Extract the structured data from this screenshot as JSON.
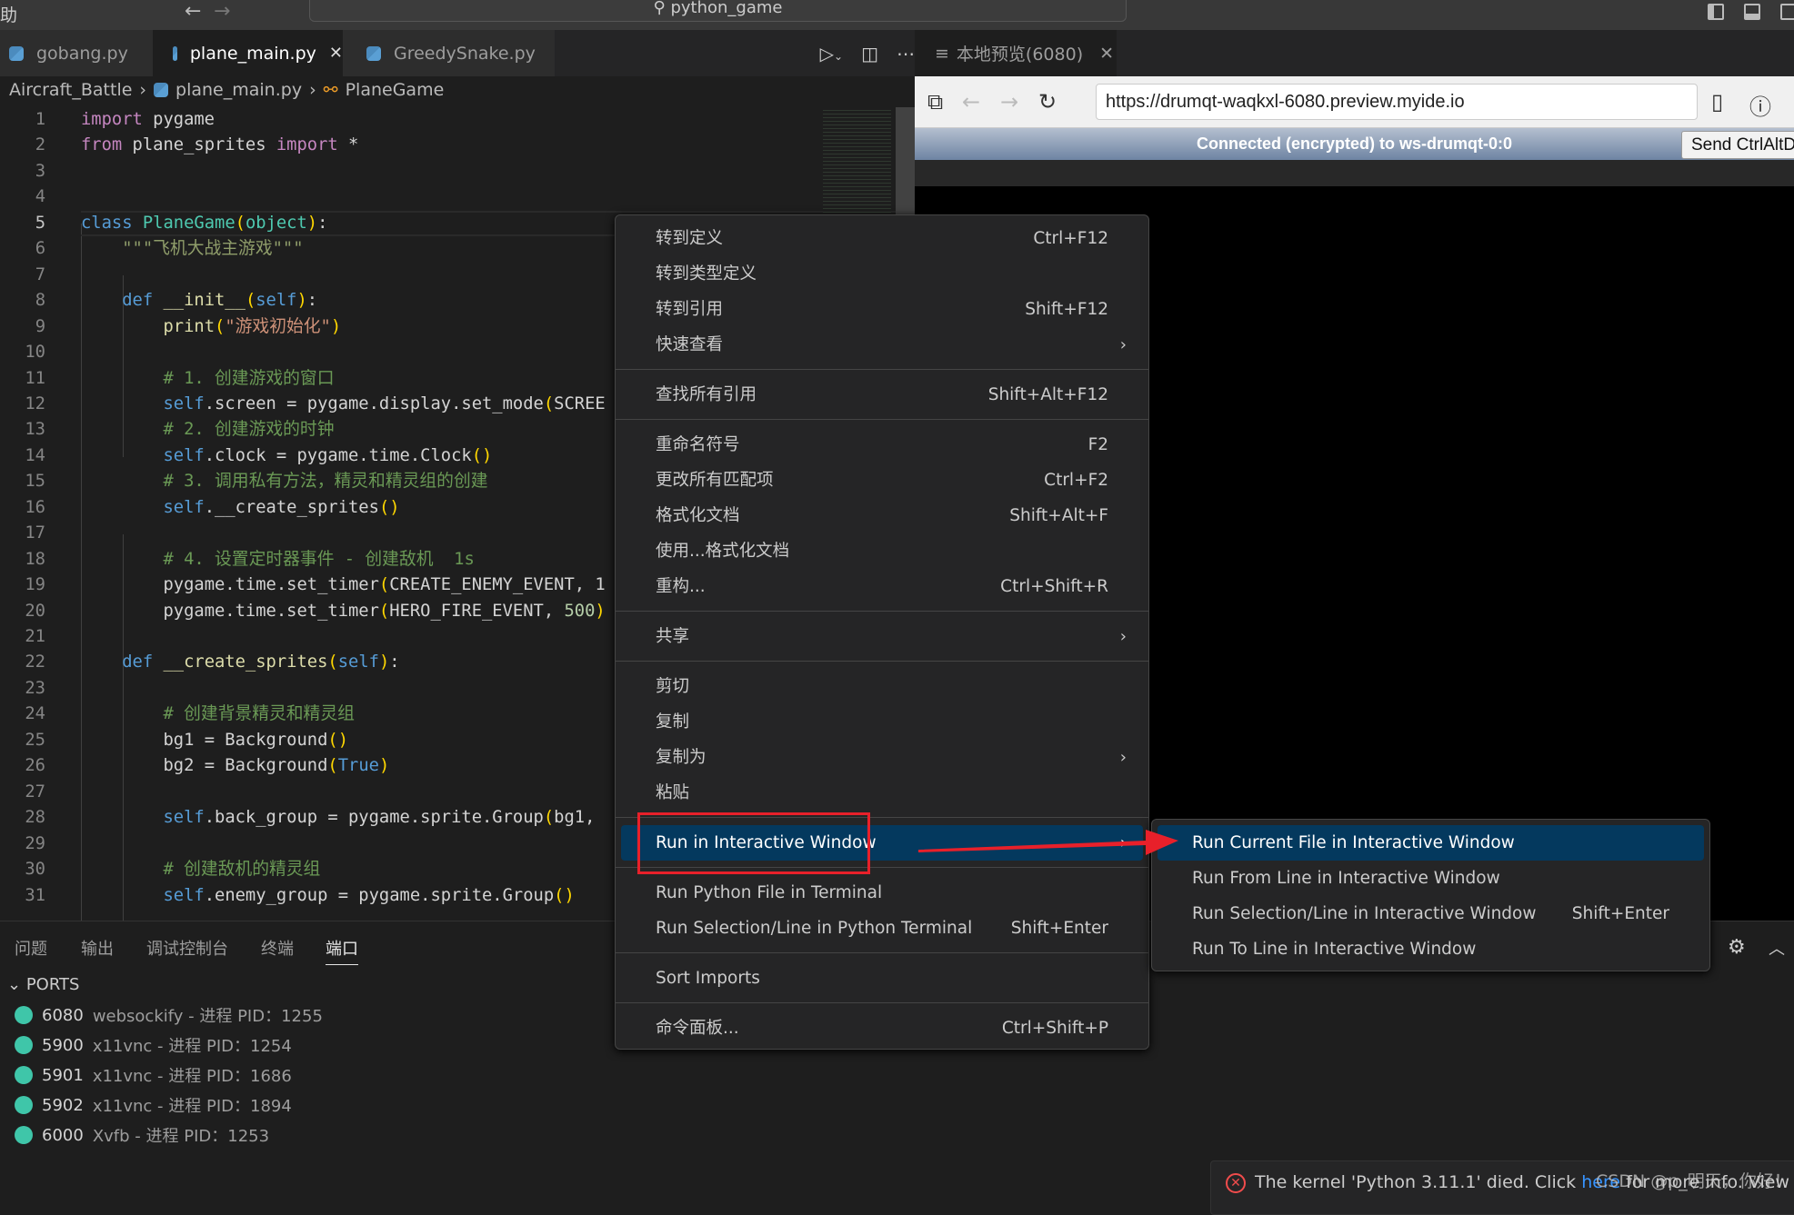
{
  "titlebar": {
    "menu_fragment": "助",
    "search": "python_game"
  },
  "tabs": [
    {
      "label": "gobang.py"
    },
    {
      "label": "plane_main.py",
      "active": true
    },
    {
      "label": "GreedySnake.py"
    }
  ],
  "breadcrumb": [
    "Aircraft_Battle",
    "plane_main.py",
    "PlaneGame"
  ],
  "current_line": 5,
  "code": [
    [
      [
        "import",
        "kw"
      ],
      [
        " pygame",
        ""
      ]
    ],
    [
      [
        "from",
        "kw"
      ],
      [
        " plane_sprites ",
        ""
      ],
      [
        "import",
        "kw"
      ],
      [
        " *",
        ""
      ]
    ],
    [],
    [],
    [
      [
        "class",
        "st"
      ],
      [
        " ",
        ""
      ],
      [
        "PlaneGame",
        "cls"
      ],
      [
        "(",
        "br"
      ],
      [
        "object",
        "cls"
      ],
      [
        ")",
        "br"
      ],
      [
        ":",
        ""
      ]
    ],
    [
      [
        "    ",
        ""
      ],
      [
        "\"\"\"飞机大战主游戏\"\"\"",
        "doc"
      ]
    ],
    [],
    [
      [
        "    ",
        ""
      ],
      [
        "def",
        "st"
      ],
      [
        " ",
        ""
      ],
      [
        "__init__",
        "fn"
      ],
      [
        "(",
        "br"
      ],
      [
        "self",
        "st"
      ],
      [
        ")",
        "br"
      ],
      [
        ":",
        ""
      ]
    ],
    [
      [
        "        ",
        ""
      ],
      [
        "print",
        "fn"
      ],
      [
        "(",
        "br"
      ],
      [
        "\"游戏初始化\"",
        "str"
      ],
      [
        ")",
        "br"
      ]
    ],
    [],
    [
      [
        "        ",
        ""
      ],
      [
        "# 1. 创建游戏的窗口",
        "cm"
      ]
    ],
    [
      [
        "        ",
        ""
      ],
      [
        "self",
        "st"
      ],
      [
        ".screen = pygame.display.set_mode",
        ""
      ],
      [
        "(",
        "br"
      ],
      [
        "SCREE",
        ""
      ]
    ],
    [
      [
        "        ",
        ""
      ],
      [
        "# 2. 创建游戏的时钟",
        "cm"
      ]
    ],
    [
      [
        "        ",
        ""
      ],
      [
        "self",
        "st"
      ],
      [
        ".clock = pygame.time.Clock",
        ""
      ],
      [
        "()",
        "br"
      ]
    ],
    [
      [
        "        ",
        ""
      ],
      [
        "# 3. 调用私有方法，精灵和精灵组的创建",
        "cm"
      ]
    ],
    [
      [
        "        ",
        ""
      ],
      [
        "self",
        "st"
      ],
      [
        ".__create_sprites",
        ""
      ],
      [
        "()",
        "br"
      ]
    ],
    [],
    [
      [
        "        ",
        ""
      ],
      [
        "# 4. 设置定时器事件 - 创建敌机  1s",
        "cm"
      ]
    ],
    [
      [
        "        ",
        ""
      ],
      [
        "pygame.time.set_timer",
        ""
      ],
      [
        "(",
        "br"
      ],
      [
        "CREATE_ENEMY_EVENT, 1",
        ""
      ]
    ],
    [
      [
        "        ",
        ""
      ],
      [
        "pygame.time.set_timer",
        ""
      ],
      [
        "(",
        "br"
      ],
      [
        "HERO_FIRE_EVENT, ",
        ""
      ],
      [
        "500",
        "num"
      ],
      [
        ")",
        "br"
      ]
    ],
    [],
    [
      [
        "    ",
        ""
      ],
      [
        "def",
        "st"
      ],
      [
        " ",
        ""
      ],
      [
        "__create_sprites",
        "fn"
      ],
      [
        "(",
        "br"
      ],
      [
        "self",
        "st"
      ],
      [
        ")",
        "br"
      ],
      [
        ":",
        ""
      ]
    ],
    [],
    [
      [
        "        ",
        ""
      ],
      [
        "# 创建背景精灵和精灵组",
        "cm"
      ]
    ],
    [
      [
        "        ",
        ""
      ],
      [
        "bg1 = Background",
        ""
      ],
      [
        "()",
        "br"
      ]
    ],
    [
      [
        "        ",
        ""
      ],
      [
        "bg2 = Background",
        ""
      ],
      [
        "(",
        "br"
      ],
      [
        "True",
        "st"
      ],
      [
        ")",
        "br"
      ]
    ],
    [],
    [
      [
        "        ",
        ""
      ],
      [
        "self",
        "st"
      ],
      [
        ".back_group = pygame.sprite.Group",
        ""
      ],
      [
        "(",
        "br"
      ],
      [
        "bg1,",
        ""
      ]
    ],
    [],
    [
      [
        "        ",
        ""
      ],
      [
        "# 创建敌机的精灵组",
        "cm"
      ]
    ],
    [
      [
        "        ",
        ""
      ],
      [
        "self",
        "st"
      ],
      [
        ".enemy_group = pygame.sprite.Group",
        ""
      ],
      [
        "()",
        "br"
      ]
    ]
  ],
  "preview": {
    "tab_label": "本地预览(6080)",
    "url": "https://drumqt-waqkxl-6080.preview.myide.io",
    "status": "Connected (encrypted) to ws-drumqt-0:0",
    "send_button": "Send CtrlAltDel"
  },
  "panel": {
    "tabs": [
      "问题",
      "输出",
      "调试控制台",
      "终端",
      "端口"
    ],
    "active_tab": "端口",
    "section": "PORTS",
    "ports": [
      {
        "port": "6080",
        "desc": "websockify - 进程 PID：1255"
      },
      {
        "port": "5900",
        "desc": "x11vnc - 进程 PID：1254"
      },
      {
        "port": "5901",
        "desc": "x11vnc - 进程 PID：1686"
      },
      {
        "port": "5902",
        "desc": "x11vnc - 进程 PID：1894"
      },
      {
        "port": "6000",
        "desc": "Xvfb - 进程 PID：1253"
      }
    ]
  },
  "context_menu": [
    {
      "label": "转到定义",
      "shortcut": "Ctrl+F12"
    },
    {
      "label": "转到类型定义"
    },
    {
      "label": "转到引用",
      "shortcut": "Shift+F12"
    },
    {
      "label": "快速查看",
      "submenu": true
    },
    {
      "sep": true
    },
    {
      "label": "查找所有引用",
      "shortcut": "Shift+Alt+F12"
    },
    {
      "sep": true
    },
    {
      "label": "重命名符号",
      "shortcut": "F2"
    },
    {
      "label": "更改所有匹配项",
      "shortcut": "Ctrl+F2"
    },
    {
      "label": "格式化文档",
      "shortcut": "Shift+Alt+F"
    },
    {
      "label": "使用...格式化文档"
    },
    {
      "label": "重构...",
      "shortcut": "Ctrl+Shift+R"
    },
    {
      "sep": true
    },
    {
      "label": "共享",
      "submenu": true
    },
    {
      "sep": true
    },
    {
      "label": "剪切"
    },
    {
      "label": "复制"
    },
    {
      "label": "复制为",
      "submenu": true
    },
    {
      "label": "粘贴"
    },
    {
      "sep": true
    },
    {
      "label": "Run in Interactive Window",
      "submenu": true,
      "highlighted": true
    },
    {
      "sep": true
    },
    {
      "label": "Run Python File in Terminal"
    },
    {
      "label": "Run Selection/Line in Python Terminal",
      "shortcut": "Shift+Enter"
    },
    {
      "sep": true
    },
    {
      "label": "Sort Imports"
    },
    {
      "sep": true
    },
    {
      "label": "命令面板...",
      "shortcut": "Ctrl+Shift+P"
    }
  ],
  "submenu": [
    {
      "label": "Run Current File in Interactive Window",
      "highlighted": true
    },
    {
      "label": "Run From Line in Interactive Window"
    },
    {
      "label": "Run Selection/Line in Interactive Window",
      "shortcut": "Shift+Enter"
    },
    {
      "label": "Run To Line in Interactive Window"
    }
  ],
  "notification": {
    "before": "The kernel 'Python 3.11.1' died. Click ",
    "link": "here",
    "after": " for more info. View Jupyter"
  },
  "watermark": "CSDN @p_明天，你好！",
  "colors": {
    "accent_highlight": "#04395e",
    "annotation_red": "#e8202a",
    "port_status": "#3fc6a9"
  }
}
